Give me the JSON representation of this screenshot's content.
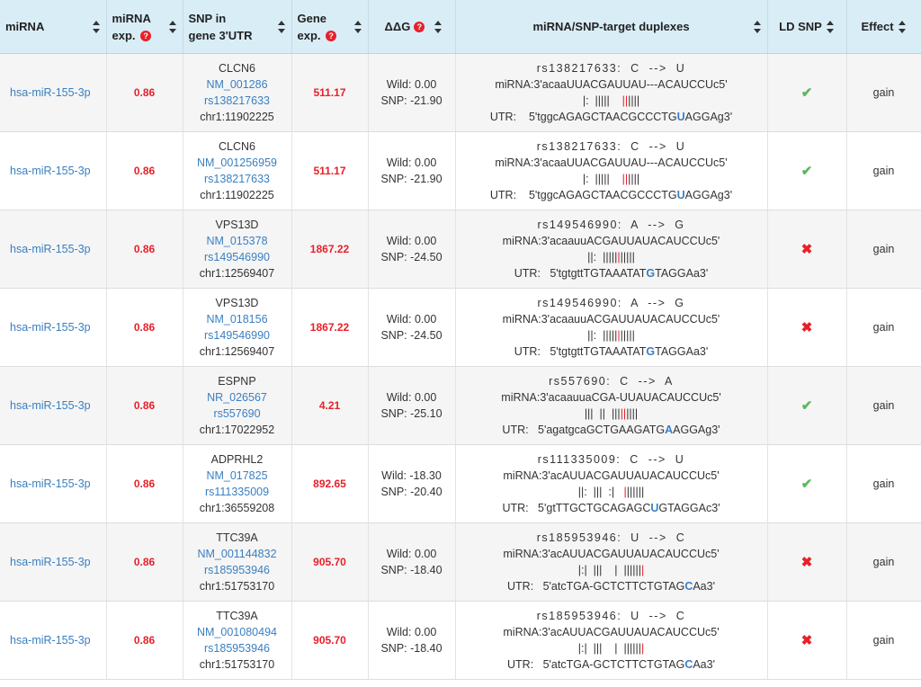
{
  "headers": {
    "mirna": "miRNA",
    "mirna_exp_1": "miRNA",
    "mirna_exp_2": "exp.",
    "snp_gene_1": "SNP in",
    "snp_gene_2": "gene 3'UTR",
    "gene_exp_1": "Gene",
    "gene_exp_2": "exp.",
    "ddg": "ΔΔG",
    "duplex": "miRNA/SNP-target duplexes",
    "ld_snp": "LD SNP",
    "effect": "Effect"
  },
  "colors": {
    "header_bg": "#d9edf7",
    "link": "#3a7fc1",
    "value_red": "#e8202a",
    "check_green": "#5cb85c"
  },
  "rows": [
    {
      "mirna": "hsa-miR-155-3p",
      "mirna_exp": "0.86",
      "gene": "CLCN6",
      "transcript": "NM_001286",
      "snp": "rs138217633",
      "chr": "chr1:11902225",
      "gene_exp": "511.17",
      "wild": "Wild: 0.00",
      "snp_dg": "SNP: -21.90",
      "d1": "rs138217633:  C  -->  U",
      "d2": "miRNA:3'acaaUUACGAUUAU---ACAUCCUc5'",
      "d3a": "|:  |||||    ",
      "d3b": "||",
      "d3c": "||||",
      "d4a": "UTR:    5'tggcAGAGCTAACGCCCTG",
      "d4m": "U",
      "d4b": "AGGAg3'",
      "ld": "check",
      "effect": "gain"
    },
    {
      "mirna": "hsa-miR-155-3p",
      "mirna_exp": "0.86",
      "gene": "CLCN6",
      "transcript": "NM_001256959",
      "snp": "rs138217633",
      "chr": "chr1:11902225",
      "gene_exp": "511.17",
      "wild": "Wild: 0.00",
      "snp_dg": "SNP: -21.90",
      "d1": "rs138217633:  C  -->  U",
      "d2": "miRNA:3'acaaUUACGAUUAU---ACAUCCUc5'",
      "d3a": "|:  |||||    ",
      "d3b": "||",
      "d3c": "||||",
      "d4a": "UTR:    5'tggcAGAGCTAACGCCCTG",
      "d4m": "U",
      "d4b": "AGGAg3'",
      "ld": "check",
      "effect": "gain"
    },
    {
      "mirna": "hsa-miR-155-3p",
      "mirna_exp": "0.86",
      "gene": "VPS13D",
      "transcript": "NM_015378",
      "snp": "rs149546990",
      "chr": "chr1:12569407",
      "gene_exp": "1867.22",
      "wild": "Wild: 0.00",
      "snp_dg": "SNP: -24.50",
      "d1": "rs149546990:  A  -->  G",
      "d2": "miRNA:3'acaauuACGAUUAUACAUCCUc5'",
      "d3a": "||:  |||||",
      "d3b": "|",
      "d3c": "|||||",
      "d4a": "UTR:   5'tgtgttTGTAAATAT",
      "d4m": "G",
      "d4b": "TAGGAa3'",
      "ld": "cross",
      "effect": "gain"
    },
    {
      "mirna": "hsa-miR-155-3p",
      "mirna_exp": "0.86",
      "gene": "VPS13D",
      "transcript": "NM_018156",
      "snp": "rs149546990",
      "chr": "chr1:12569407",
      "gene_exp": "1867.22",
      "wild": "Wild: 0.00",
      "snp_dg": "SNP: -24.50",
      "d1": "rs149546990:  A  -->  G",
      "d2": "miRNA:3'acaauuACGAUUAUACAUCCUc5'",
      "d3a": "||:  |||||",
      "d3b": "|",
      "d3c": "|||||",
      "d4a": "UTR:   5'tgtgttTGTAAATAT",
      "d4m": "G",
      "d4b": "TAGGAa3'",
      "ld": "cross",
      "effect": "gain"
    },
    {
      "mirna": "hsa-miR-155-3p",
      "mirna_exp": "0.86",
      "gene": "ESPNP",
      "transcript": "NR_026567",
      "snp": "rs557690",
      "chr": "chr1:17022952",
      "gene_exp": "4.21",
      "wild": "Wild: 0.00",
      "snp_dg": "SNP: -25.10",
      "d1": "rs557690:  C  -->  A",
      "d2": "miRNA:3'acaauuaCGA-UUAUACAUCCUc5'",
      "d3a": "|||  ||  |||",
      "d3b": "||",
      "d3c": "||||",
      "d4a": "UTR:   5'agatgcaGCTGAAGATG",
      "d4m": "A",
      "d4b": "AGGAg3'",
      "ld": "check",
      "effect": "gain"
    },
    {
      "mirna": "hsa-miR-155-3p",
      "mirna_exp": "0.86",
      "gene": "ADPRHL2",
      "transcript": "NM_017825",
      "snp": "rs111335009",
      "chr": "chr1:36559208",
      "gene_exp": "892.65",
      "wild": "Wild: -18.30",
      "snp_dg": "SNP: -20.40",
      "d1": "rs111335009:  C  -->  U",
      "d2": "miRNA:3'acAUUACGAUUAUACAUCCUc5'",
      "d3a": "||:  |||  :|   ",
      "d3b": "|",
      "d3c": "||||||",
      "d4a": "UTR:   5'gtTTGCTGCAGAGC",
      "d4m": "U",
      "d4b": "GTAGGAc3'",
      "ld": "check",
      "effect": "gain"
    },
    {
      "mirna": "hsa-miR-155-3p",
      "mirna_exp": "0.86",
      "gene": "TTC39A",
      "transcript": "NM_001144832",
      "snp": "rs185953946",
      "chr": "chr1:51753170",
      "gene_exp": "905.70",
      "wild": "Wild: 0.00",
      "snp_dg": "SNP: -18.40",
      "d1": "rs185953946:  U  -->  C",
      "d2": "miRNA:3'acAUUACGAUUAUACAUCCUc5'",
      "d3a": "|:|  |||    |  ||||||",
      "d3b": "|",
      "d3c": "",
      "d4a": "UTR:   5'atcTGA-GCTCTTCTGTAG",
      "d4m": "C",
      "d4b": "Aa3'",
      "ld": "cross",
      "effect": "gain"
    },
    {
      "mirna": "hsa-miR-155-3p",
      "mirna_exp": "0.86",
      "gene": "TTC39A",
      "transcript": "NM_001080494",
      "snp": "rs185953946",
      "chr": "chr1:51753170",
      "gene_exp": "905.70",
      "wild": "Wild: 0.00",
      "snp_dg": "SNP: -18.40",
      "d1": "rs185953946:  U  -->  C",
      "d2": "miRNA:3'acAUUACGAUUAUACAUCCUc5'",
      "d3a": "|:|  |||    |  ||||||",
      "d3b": "|",
      "d3c": "",
      "d4a": "UTR:   5'atcTGA-GCTCTTCTGTAG",
      "d4m": "C",
      "d4b": "Aa3'",
      "ld": "cross",
      "effect": "gain"
    }
  ]
}
